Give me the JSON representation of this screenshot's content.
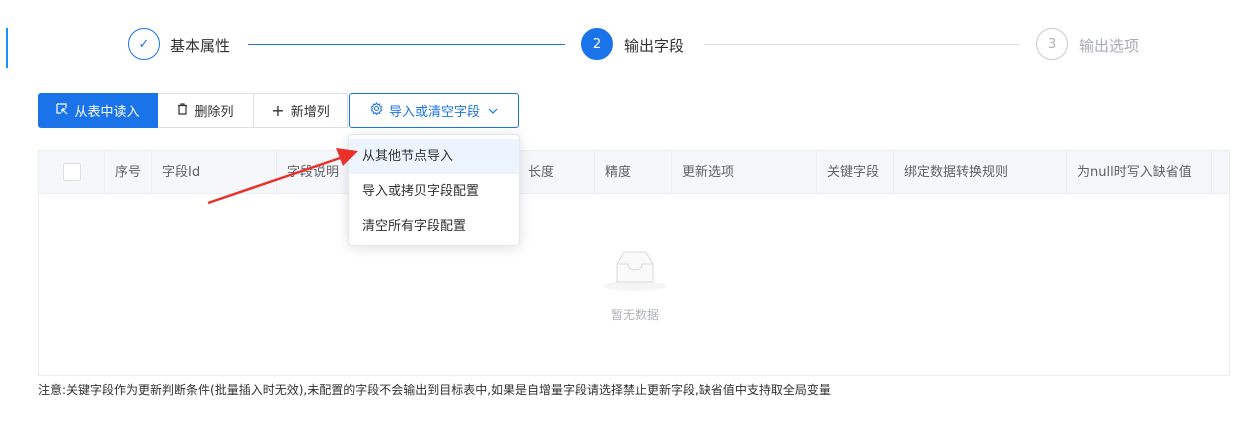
{
  "steps": [
    {
      "index": "✓",
      "title": "基本属性",
      "status": "done"
    },
    {
      "index": "2",
      "title": "输出字段",
      "status": "active"
    },
    {
      "index": "3",
      "title": "输出选项",
      "status": "wait"
    }
  ],
  "toolbar": {
    "read_from_table": "从表中读入",
    "delete_column": "删除列",
    "add_column": "新增列",
    "import_or_clear": "导入或清空字段"
  },
  "dropdown": {
    "items": [
      "从其他节点导入",
      "导入或拷贝字段配置",
      "清空所有字段配置"
    ]
  },
  "table": {
    "columns": [
      "序号",
      "字段Id",
      "字段说明",
      "长度",
      "精度",
      "更新选项",
      "关键字段",
      "绑定数据转换规则",
      "为null时写入缺省值"
    ],
    "empty_text": "暂无数据"
  },
  "note": "注意:关键字段作为更新判断条件(批量插入时无效),未配置的字段不会输出到目标表中,如果是自增量字段请选择禁止更新字段,缺省值中支持取全局变量",
  "colors": {
    "primary": "#1a73e8",
    "annotation_arrow": "#e8322b"
  }
}
